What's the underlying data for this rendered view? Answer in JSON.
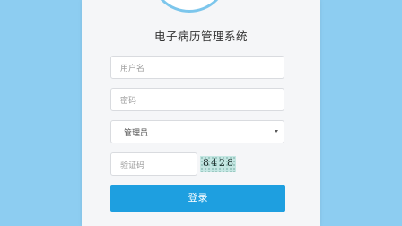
{
  "app": {
    "title": "电子病历管理系统"
  },
  "form": {
    "username": {
      "placeholder": "用户名"
    },
    "password": {
      "placeholder": "密码"
    },
    "role": {
      "selected": "管理员"
    },
    "captcha": {
      "placeholder": "验证码",
      "code": "8428"
    },
    "login_label": "登录"
  },
  "colors": {
    "background": "#8dcdf1",
    "panel": "#f5f6f8",
    "primary": "#1e9fe0",
    "avatar_ring": "#7cc6ec"
  },
  "icons": [
    "chevron-down-icon"
  ]
}
